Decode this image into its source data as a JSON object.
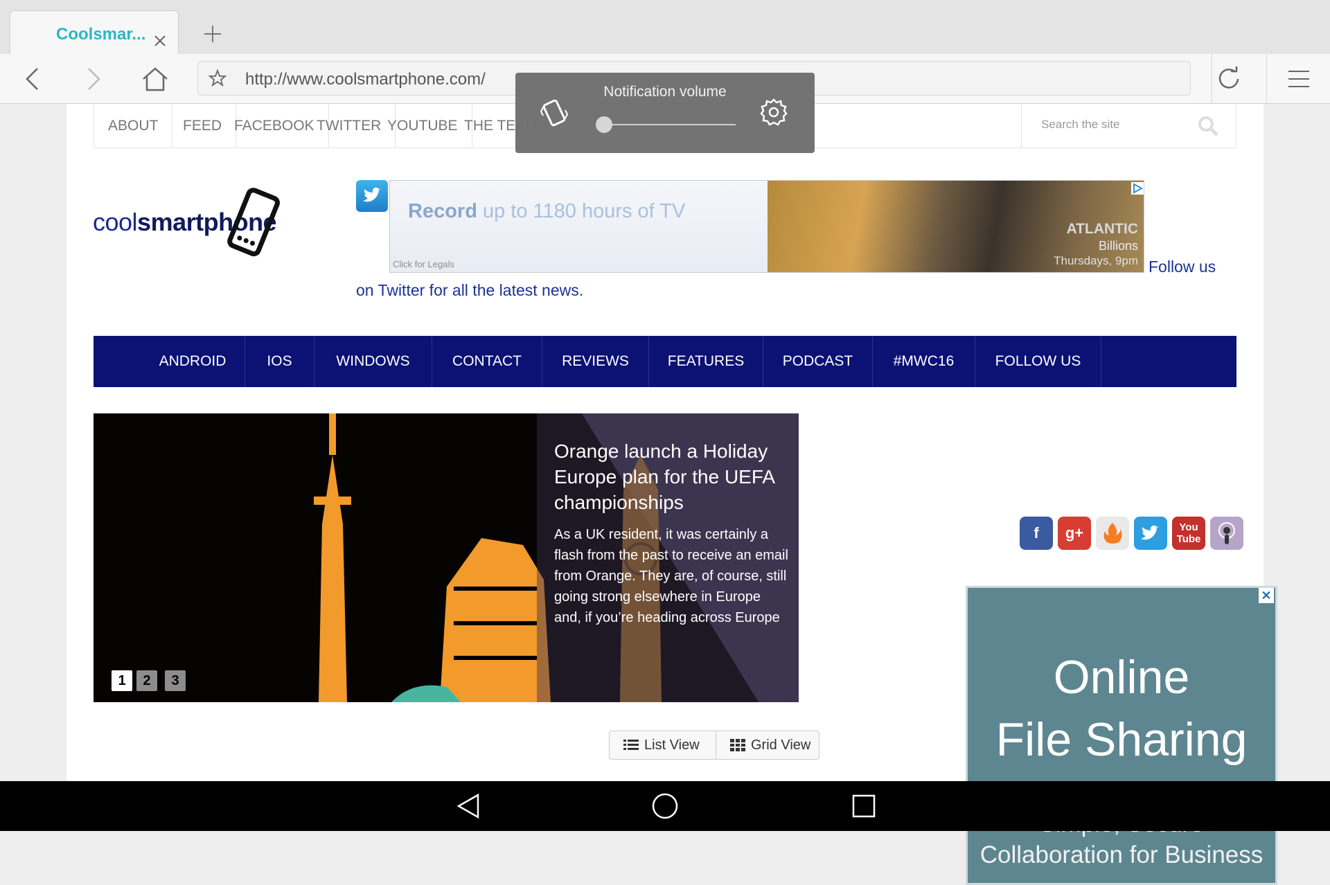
{
  "browser": {
    "tab_title": "Coolsmar...",
    "url": "http://www.coolsmartphone.com/"
  },
  "top_nav": {
    "items": [
      "ABOUT",
      "FEED",
      "FACEBOOK",
      "TWITTER",
      "YOUTUBE",
      "THE TEAM"
    ],
    "search_placeholder": "Search the site"
  },
  "logo": {
    "part1": "cool",
    "part2": "smartphone"
  },
  "ad_banner": {
    "headline_bold": "Record",
    "headline_rest": " up to 1180 hours of TV",
    "legal": "Click for Legals",
    "brand": "ATLANTIC",
    "sub1": "Billions",
    "sub2": "Thursdays, 9pm"
  },
  "follow_text": {
    "line1": "Follow us",
    "line2": "on Twitter for all the latest news."
  },
  "main_nav": [
    "ANDROID",
    "IOS",
    "WINDOWS",
    "CONTACT",
    "REVIEWS",
    "FEATURES",
    "PODCAST",
    "#MWC16",
    "FOLLOW US"
  ],
  "slider": {
    "title": "Orange launch a Holiday Europe plan for the UEFA championships",
    "excerpt": "As a UK resident, it was certainly a flash from the past to receive an email from Orange. They are, of course, still going strong elsewhere in Europe and, if you’re heading across Europe",
    "pages": [
      "1",
      "2",
      "3"
    ],
    "active_page": 1
  },
  "view_buttons": {
    "list": "List View",
    "grid": "Grid View"
  },
  "social_icons": [
    "facebook-icon",
    "google-plus-icon",
    "feedburner-icon",
    "twitter-icon",
    "youtube-icon",
    "podcast-icon"
  ],
  "social_labels": {
    "google": "g+",
    "youtube_top": "You",
    "youtube_bottom": "Tube"
  },
  "side_ad": {
    "headline_1": "Online",
    "headline_2": "File Sharing",
    "sub_1": "Simple, Secure",
    "sub_2": "Collaboration for Business",
    "close": "✕"
  },
  "volume_overlay": {
    "title": "Notification volume",
    "level": 0.0
  },
  "colors": {
    "accent_tab": "#2bb6c7",
    "main_nav_bg": "#0b1274",
    "link": "#1a3396"
  }
}
